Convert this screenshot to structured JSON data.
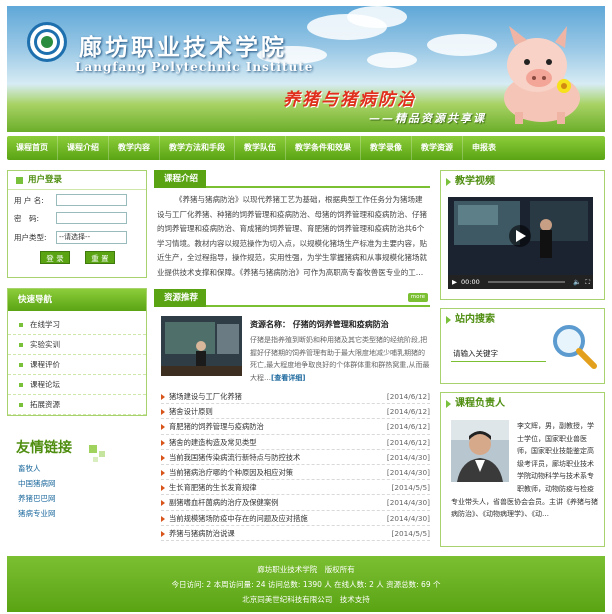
{
  "header": {
    "school_name_cn": "廊坊职业技术学院",
    "school_name_en": "Langfang Polytechnic Institute",
    "banner_title": "养猪与猪病防治",
    "banner_subtitle": "——精品资源共享课"
  },
  "nav": {
    "items": [
      "课程首页",
      "课程介绍",
      "教学内容",
      "教学方法和手段",
      "教学队伍",
      "教学条件和效果",
      "教学录像",
      "教学资源",
      "申报表"
    ]
  },
  "login": {
    "title": "用户登录",
    "username_label": "用 户 名:",
    "password_label": "密　码:",
    "user_type_label": "用户类型:",
    "user_type_selected": "--请选择--",
    "login_button": "登 录",
    "reset_button": "重 置"
  },
  "quick_nav": {
    "title": "快速导航",
    "items": [
      "在线学习",
      "实验实训",
      "课程评价",
      "课程论坛",
      "拓展资源"
    ]
  },
  "friend_links": {
    "title": "友情链接",
    "items": [
      "畜牧人",
      "中国猪病网",
      "养猪巴巴网",
      "猪病专业网"
    ]
  },
  "intro": {
    "title": "课程介绍",
    "text": "《养猪与猪病防治》以现代养猪工艺为基础，根据典型工作任务分为猪场建设与工厂化养猪、种猪的饲养管理和疫病防治、母猪的饲养管理和疫病防治、仔猪的饲养管理和疫病防治、育成猪的饲养管理、育肥猪的饲养管理和疫病防治共6个学习情境。教材内容以规范操作为切入点，以规模化猪场生产标准为主要内容，贴近生产，全过程指导，操作规范，实用性强，为学生掌握猪病和从事规模化猪场就业提供技术支撑和保障。《养猪与猪病防治》可作为高职高专畜牧兽医专业的工…"
  },
  "recommend": {
    "title": "资源推荐",
    "more_label": "more",
    "item_title": "资源名称：  仔猪的饲养管理和疫病防治",
    "item_desc": "仔猪是指养殖到断奶和种用猪及其它类型猪的经统阶段,把握好仔猪期的饲养管理有助于最大限度地减少哺乳期猪的死亡,最大程度地争取良好的个体群体重和群热窝重,从而最大程…",
    "item_more": "[查看详细]"
  },
  "news": [
    {
      "title": "猪场建设与工厂化养猪",
      "date": "[2014/6/12]"
    },
    {
      "title": "猪舍设计原则",
      "date": "[2014/6/12]"
    },
    {
      "title": "育肥猪的饲养管理与疫病防治",
      "date": "[2014/6/12]"
    },
    {
      "title": "猪舍的建造构造及常见类型",
      "date": "[2014/6/12]"
    },
    {
      "title": "当前我国猪传染病流行新特点与防控技术",
      "date": "[2014/4/30]"
    },
    {
      "title": "当前猪病治疗哪的个种原因及相应对策",
      "date": "[2014/4/30]"
    },
    {
      "title": "生长育肥猪的生长发育规律",
      "date": "[2014/5/5]"
    },
    {
      "title": "副猪嗜血杆菌病的治疗及保健案例",
      "date": "[2014/4/30]"
    },
    {
      "title": "当前规模猪场防疫中存在的问题及应对措施",
      "date": "[2014/4/30]"
    },
    {
      "title": "养猪与猪病防治说课",
      "date": "[2014/5/5]"
    }
  ],
  "video": {
    "title": "教学视频",
    "time": "00:00"
  },
  "site_search": {
    "title": "站内搜索",
    "placeholder": "请输入关键字"
  },
  "leader": {
    "title": "课程负责人",
    "bio": "李文辉，男，副教授，学士学位，国家职业兽医师，国家职业技能鉴定高级考评员，廊坊职业技术学院动物科学与技术系专职教师，动物防疫与检疫专业带头人，省兽医协会会员。主讲《养猪与猪病防治》、《动物病理学》、《动…"
  },
  "footer": {
    "line1": "廊坊职业技术学院　版权所有",
    "line2": "今日访问: 2  本周访问量: 24  访问总数: 1390 人  在线人数: 2 人  资源总数: 69 个",
    "line3": "北京同美世纪科技有限公司　技术支持"
  },
  "colors": {
    "brand_green": "#5aa414",
    "light_green": "#8ccd3a",
    "title_red": "#e0301d"
  }
}
